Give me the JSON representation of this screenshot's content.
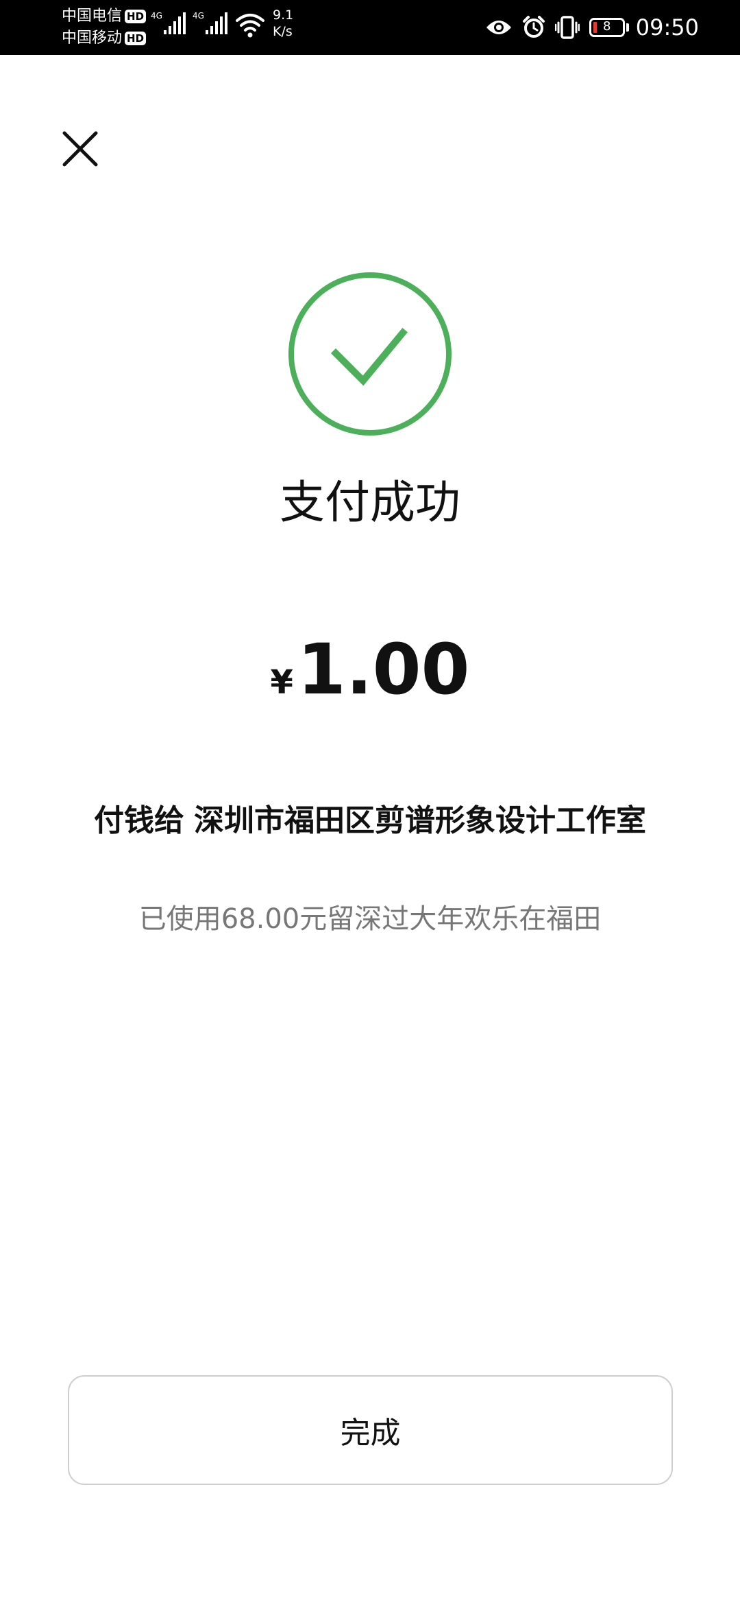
{
  "status_bar": {
    "carrier_1": "中国电信",
    "carrier_2": "中国移动",
    "hd_label": "HD",
    "network_1": "4G",
    "network_2": "4G",
    "speed_value": "9.1",
    "speed_unit": "K/s",
    "battery_level": "8",
    "time": "09:50",
    "icons": [
      "eye-icon",
      "alarm-icon",
      "vibrate-icon",
      "battery-icon"
    ]
  },
  "header": {
    "close_icon": "close-icon"
  },
  "result": {
    "title": "支付成功",
    "currency_symbol": "¥",
    "amount": "1.00",
    "payee_prefix": "付钱给",
    "payee_name": "深圳市福田区剪谱形象设计工作室",
    "coupon_note": "已使用68.00元留深过大年欢乐在福田"
  },
  "footer": {
    "done_label": "完成"
  },
  "colors": {
    "success_green": "#4caf5a",
    "text_primary": "#111111",
    "text_secondary": "#777777",
    "button_border": "#cfcfcf",
    "battery_low": "#e53935"
  }
}
